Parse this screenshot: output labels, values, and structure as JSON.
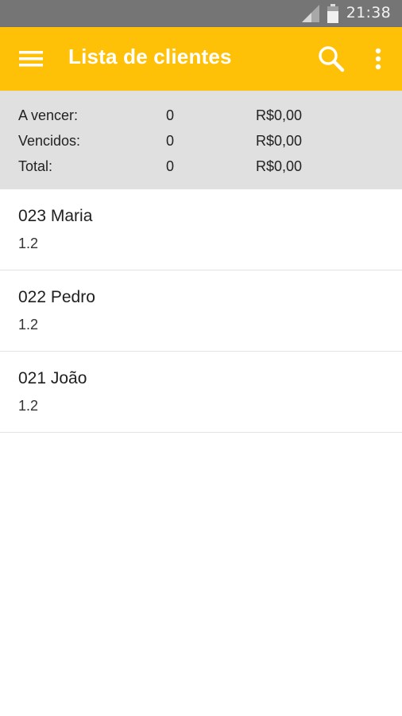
{
  "status_bar": {
    "time": "21:38",
    "icons": [
      "signal-icon",
      "battery-icon"
    ]
  },
  "app_bar": {
    "title": "Lista de clientes",
    "color": "#FFC107",
    "icons": [
      "menu-icon",
      "search-icon",
      "more-vert-icon"
    ]
  },
  "summary": {
    "rows": [
      {
        "label": "A vencer:",
        "count": "0",
        "amount": "R$0,00"
      },
      {
        "label": "Vencidos:",
        "count": "0",
        "amount": "R$0,00"
      },
      {
        "label": "Total:",
        "count": "0",
        "amount": "R$0,00"
      }
    ]
  },
  "clients": [
    {
      "name": "023 Maria",
      "sub": "1.2"
    },
    {
      "name": "022 Pedro",
      "sub": "1.2"
    },
    {
      "name": "021 João",
      "sub": "1.2"
    }
  ]
}
